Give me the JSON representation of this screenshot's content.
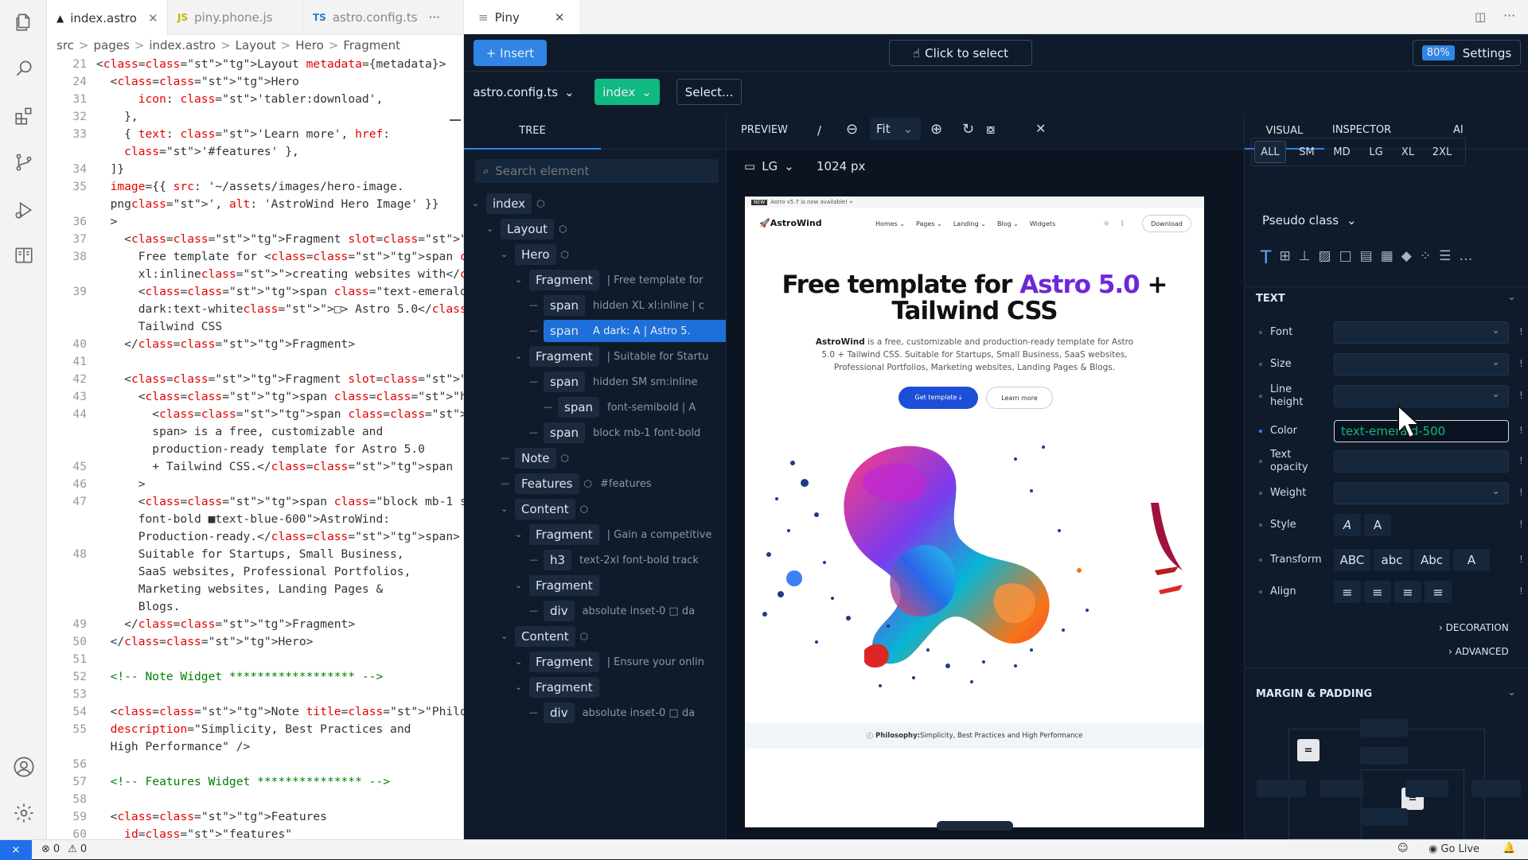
{
  "editor": {
    "tabs": [
      {
        "icon": "astro-icon",
        "label": "index.astro",
        "active": true
      },
      {
        "icon": "JS",
        "label": "piny.phone.js"
      },
      {
        "icon": "TS",
        "label": "astro.config.ts"
      }
    ],
    "tabs_more": "···",
    "breadcrumb": [
      "src",
      ">",
      "pages",
      ">",
      "index.astro",
      ">",
      "Layout",
      ">",
      "Hero",
      ">",
      "Fragment"
    ],
    "lines": [
      {
        "n": "21",
        "t": "<Layout metadata={metadata}>"
      },
      {
        "n": "24",
        "t": "  <Hero"
      },
      {
        "n": "31",
        "t": "      icon: 'tabler:download',"
      },
      {
        "n": "32",
        "t": "    },"
      },
      {
        "n": "33",
        "t": "    { text: 'Learn more', href:"
      },
      {
        "n": "",
        "t": "    '#features' },"
      },
      {
        "n": "34",
        "t": "  ]}"
      },
      {
        "n": "35",
        "t": "  image={{ src: '~/assets/images/hero-image."
      },
      {
        "n": "",
        "t": "  png', alt: 'AstroWind Hero Image' }}"
      },
      {
        "n": "36",
        "t": "  >"
      },
      {
        "n": "37",
        "t": "    <Fragment slot=\"title\">"
      },
      {
        "n": "38",
        "t": "      Free template for <span class=\"hidden"
      },
      {
        "n": "",
        "t": "      xl:inline\">creating websites with</span>"
      },
      {
        "n": "39",
        "t": "      <span class=\"text-emerald-500"
      },
      {
        "n": "",
        "t": "      dark:text-white\">□> Astro 5.0</span> +"
      },
      {
        "n": "",
        "t": "      Tailwind CSS"
      },
      {
        "n": "40",
        "t": "    </Fragment>"
      },
      {
        "n": "41",
        "t": ""
      },
      {
        "n": "42",
        "t": "    <Fragment slot=\"subtitle\">"
      },
      {
        "n": "43",
        "t": "      <span class=\"hidden sm:inline\">"
      },
      {
        "n": "44",
        "t": "        <span class=\"font-semibold\">AstroWind</"
      },
      {
        "n": "",
        "t": "        span> is a free, customizable and"
      },
      {
        "n": "",
        "t": "        production-ready template for Astro 5.0"
      },
      {
        "n": "45",
        "t": "        + Tailwind CSS.</span"
      },
      {
        "n": "46",
        "t": "      >"
      },
      {
        "n": "47",
        "t": "      <span class=\"block mb-1 sm:hidden"
      },
      {
        "n": "",
        "t": "      font-bold ■text-blue-600\">AstroWind:"
      },
      {
        "n": "",
        "t": "      Production-ready.</span>"
      },
      {
        "n": "48",
        "t": "      Suitable for Startups, Small Business,"
      },
      {
        "n": "",
        "t": "      SaaS websites, Professional Portfolios,"
      },
      {
        "n": "",
        "t": "      Marketing websites, Landing Pages &"
      },
      {
        "n": "",
        "t": "      Blogs."
      },
      {
        "n": "49",
        "t": "    </Fragment>"
      },
      {
        "n": "50",
        "t": "  </Hero>"
      },
      {
        "n": "51",
        "t": ""
      },
      {
        "n": "52",
        "t": "  <!-- Note Widget ****************** -->"
      },
      {
        "n": "53",
        "t": ""
      },
      {
        "n": "54",
        "t": "  <Note title=\"Philosophy:\""
      },
      {
        "n": "55",
        "t": "  description=\"Simplicity, Best Practices and"
      },
      {
        "n": "",
        "t": "  High Performance\" />"
      },
      {
        "n": "56",
        "t": ""
      },
      {
        "n": "57",
        "t": "  <!-- Features Widget *************** -->"
      },
      {
        "n": "58",
        "t": ""
      },
      {
        "n": "59",
        "t": "  <Features"
      },
      {
        "n": "60",
        "t": "    id=\"features\""
      }
    ]
  },
  "piny": {
    "tab_label": "Piny",
    "insert_label": "+ Insert",
    "click_to_select": "Click to select",
    "zoom_badge": "80%",
    "settings_label": "Settings",
    "file_select": "astro.config.ts",
    "page_select": "index",
    "select_btn": "Select...",
    "tree_tab": "TREE",
    "preview_tab": "PREVIEW",
    "preview_sep": "/",
    "zoom_fit": "Fit",
    "device": "LG",
    "width_px": "1024 px",
    "search_placeholder": "Search element",
    "tree": [
      {
        "label": "index",
        "meta": "",
        "indent": 0,
        "icon": true
      },
      {
        "label": "Layout",
        "meta": "",
        "indent": 1,
        "icon": true
      },
      {
        "label": "Hero",
        "meta": "",
        "indent": 2,
        "icon": true
      },
      {
        "label": "Fragment",
        "meta": "| Free template for",
        "indent": 3
      },
      {
        "label": "span",
        "meta": "hidden XL xl:inline | c",
        "indent": 4
      },
      {
        "label": "span",
        "meta": "A dark: A | Astro 5.",
        "indent": 4,
        "selected": true
      },
      {
        "label": "Fragment",
        "meta": "| Suitable for Startu",
        "indent": 3
      },
      {
        "label": "span",
        "meta": "hidden SM sm:inline",
        "indent": 4
      },
      {
        "label": "span",
        "meta": "font-semibold | A",
        "indent": 5
      },
      {
        "label": "span",
        "meta": "block mb-1 font-bold",
        "indent": 4
      },
      {
        "label": "Note",
        "meta": "",
        "indent": 2,
        "icon": true
      },
      {
        "label": "Features",
        "meta": "#features",
        "indent": 2,
        "icon": true
      },
      {
        "label": "Content",
        "meta": "",
        "indent": 2,
        "icon": true
      },
      {
        "label": "Fragment",
        "meta": "| Gain a competitive",
        "indent": 3
      },
      {
        "label": "h3",
        "meta": "text-2xl font-bold track",
        "indent": 4
      },
      {
        "label": "Fragment",
        "meta": "",
        "indent": 3
      },
      {
        "label": "div",
        "meta": "absolute inset-0 □ da",
        "indent": 4
      },
      {
        "label": "Content",
        "meta": "",
        "indent": 2,
        "icon": true
      },
      {
        "label": "Fragment",
        "meta": "| Ensure your onlin",
        "indent": 3
      },
      {
        "label": "Fragment",
        "meta": "",
        "indent": 3
      },
      {
        "label": "div",
        "meta": "absolute inset-0 □ da",
        "indent": 4
      }
    ],
    "site": {
      "announcement": "Astro v5.7 is now available! »",
      "logo": "AstroWind",
      "nav": [
        "Homes ⌄",
        "Pages ⌄",
        "Landing ⌄",
        "Blog ⌄",
        "Widgets"
      ],
      "download": "Download",
      "headline_1": "Free template for ",
      "headline_accent": "Astro 5.0",
      "headline_2": " +",
      "headline_3": "Tailwind CSS",
      "sub_bold": "AstroWind",
      "sub_text": " is a free, customizable and production-ready template for Astro 5.0 + Tailwind CSS. Suitable for Startups, Small Business, SaaS websites, Professional Portfolios, Marketing websites, Landing Pages & Blogs.",
      "btn_primary": "Get template ⤓",
      "btn_secondary": "Learn more",
      "note_bold": "Philosophy:",
      "note_text": " Simplicity, Best Practices and High Performance"
    },
    "right": {
      "tabs": [
        "VISUAL",
        "INSPECTOR",
        "AI"
      ],
      "breakpoints": [
        "ALL",
        "SM",
        "MD",
        "LG",
        "XL",
        "2XL"
      ],
      "pseudo": "Pseudo class",
      "text_section": "TEXT",
      "fields": [
        "Font",
        "Size",
        "Line height",
        "Color",
        "Text opacity",
        "Weight",
        "Style",
        "Transform",
        "Align"
      ],
      "color_value": "text-emerald-500",
      "style_opts": [
        "A",
        "A"
      ],
      "transform_opts": [
        "ABC",
        "abc",
        "Abc",
        "A"
      ],
      "decoration": "DECORATION",
      "advanced": "ADVANCED",
      "margin_section": "MARGIN & PADDING"
    }
  },
  "status": {
    "errors": "0",
    "warnings": "0",
    "go_live": "Go Live"
  },
  "colors": {
    "accent": "#1f6feb",
    "emerald": "#10b981",
    "selected": "#1e6fd9"
  }
}
